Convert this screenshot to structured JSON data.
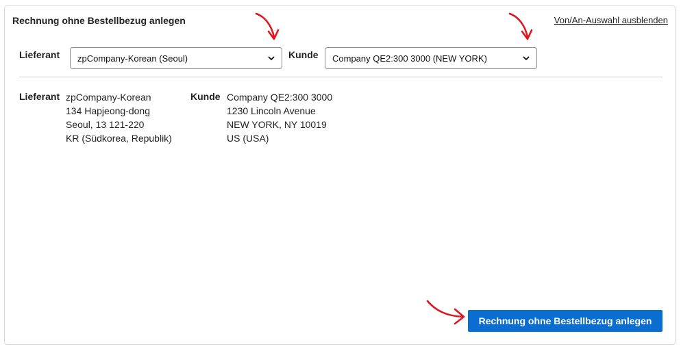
{
  "panel": {
    "title": "Rechnung ohne Bestellbezug anlegen",
    "toggle_link": "Von/An-Auswahl ausblenden"
  },
  "selectors": {
    "supplier_label": "Lieferant",
    "supplier_value": "zpCompany-Korean (Seoul)",
    "customer_label": "Kunde",
    "customer_value": "Company QE2:300 3000 (NEW YORK)"
  },
  "addresses": {
    "supplier": {
      "label": "Lieferant",
      "lines": [
        "zpCompany-Korean",
        "134 Hapjeong-dong",
        "Seoul, 13 121-220",
        "KR (Südkorea, Republik)"
      ]
    },
    "customer": {
      "label": "Kunde",
      "lines": [
        "Company QE2:300 3000",
        "1230 Lincoln Avenue",
        "NEW YORK, NY 10019",
        "US (USA)"
      ]
    }
  },
  "actions": {
    "create_button": "Rechnung ohne Bestellbezug anlegen"
  },
  "annotations": {
    "arrow_color": "#e0161e"
  },
  "colors": {
    "primary": "#0a6ed1",
    "border": "#d9d9d9"
  }
}
